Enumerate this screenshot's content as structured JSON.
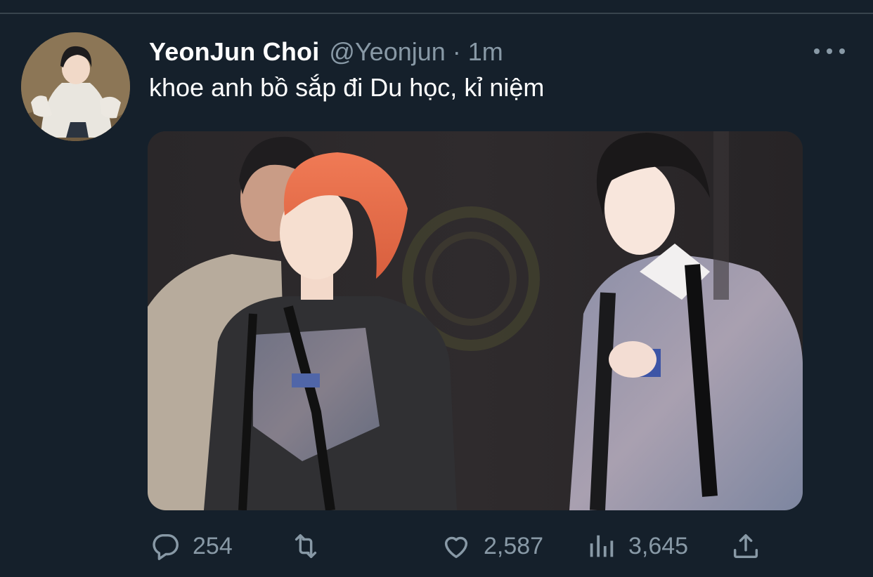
{
  "tweet": {
    "display_name": "YeonJun Choi",
    "handle": "@Yeonjun",
    "separator": "·",
    "time": "1m",
    "text": "khoe anh bồ sắp đi Du học, kỉ niệm",
    "avatar_icon": "avatar-photo",
    "media_description_icon": "photo"
  },
  "actions": {
    "reply_count": "254",
    "retweet_count": "",
    "like_count": "2,587",
    "view_count": "3,645"
  },
  "icons": {
    "reply": "reply-icon",
    "retweet": "retweet-icon",
    "like": "heart-icon",
    "views": "analytics-icon",
    "share": "share-icon",
    "more": "more-icon"
  },
  "colors": {
    "background": "#15202b",
    "text_primary": "#ffffff",
    "text_secondary": "#8899a6",
    "divider": "#38444d"
  }
}
